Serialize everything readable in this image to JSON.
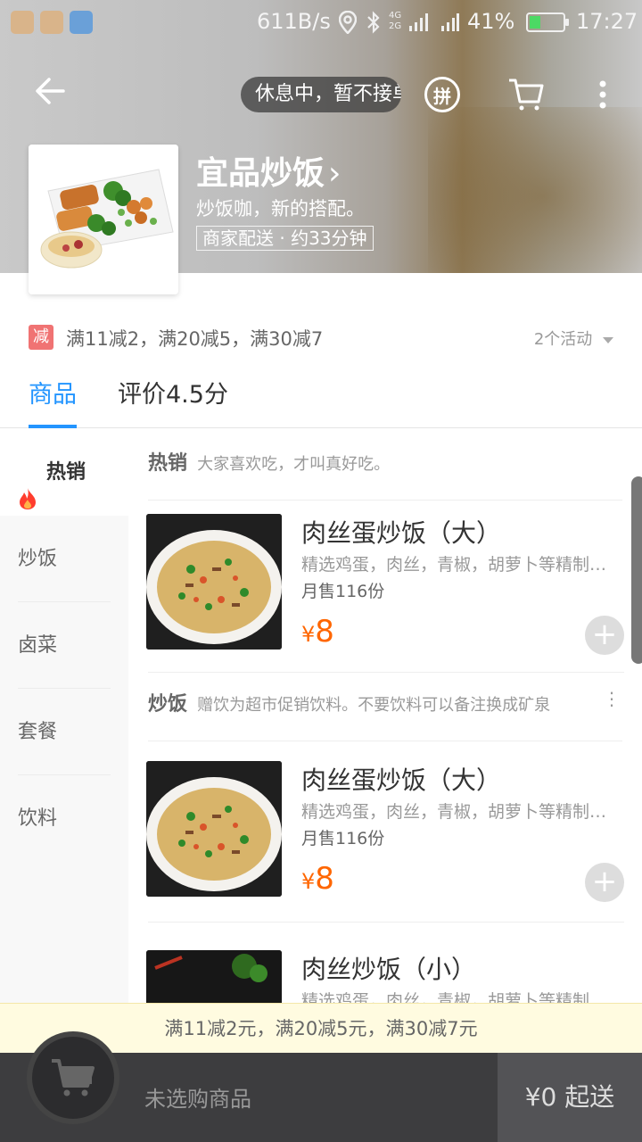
{
  "status_bar": {
    "net_speed": "611B/s",
    "signal_label": "4G 2G",
    "battery_percent": "41%",
    "battery_level": 0.41,
    "time": "17:27",
    "icons": [
      "location-icon",
      "bluetooth-icon",
      "signal-icon",
      "battery-icon"
    ]
  },
  "header": {
    "notice": "休息中，暂不接单",
    "pin_label": "拼",
    "shop_name": "宜品炒饭",
    "chevron": "›",
    "slogan": "炒饭咖，新的搭配。",
    "delivery": "商家配送 · 约33分钟"
  },
  "promo": {
    "badge": "减",
    "text": "满11减2，满20减5，满30减7",
    "activity_count": "2个活动"
  },
  "tabs": [
    {
      "label": "商品"
    },
    {
      "label": "评价4.5分"
    }
  ],
  "sidebar": {
    "items": [
      {
        "label": "热销"
      },
      {
        "label": "炒饭"
      },
      {
        "label": "卤菜"
      },
      {
        "label": "套餐"
      },
      {
        "label": "饮料"
      }
    ]
  },
  "sections": [
    {
      "title": "热销",
      "desc": "大家喜欢吃，才叫真好吃。",
      "items": [
        {
          "name": "肉丝蛋炒饭（大）",
          "desc": "精选鸡蛋，肉丝，青椒，胡萝卜等精制…",
          "sales": "月售116份",
          "currency": "¥",
          "price": "8"
        }
      ]
    },
    {
      "title": "炒饭",
      "desc": "赠饮为超市促销饮料。不要饮料可以备注换成矿泉",
      "items": [
        {
          "name": "肉丝蛋炒饭（大）",
          "desc": "精选鸡蛋，肉丝，青椒，胡萝卜等精制…",
          "sales": "月售116份",
          "currency": "¥",
          "price": "8"
        },
        {
          "name": "肉丝炒饭（小）",
          "desc": "精选鸡蛋，肉丝，青椒，胡萝卜等精制…"
        }
      ]
    }
  ],
  "discount_bar": "满11减2元，满20减5元，满30减7元",
  "cart": {
    "empty_text": "未选购商品",
    "min_order": "¥0 起送"
  },
  "colors": {
    "accent": "#2395ff",
    "price": "#ff6600",
    "promo_badge": "#f07373",
    "hot_icon": "#ff3d2e"
  }
}
